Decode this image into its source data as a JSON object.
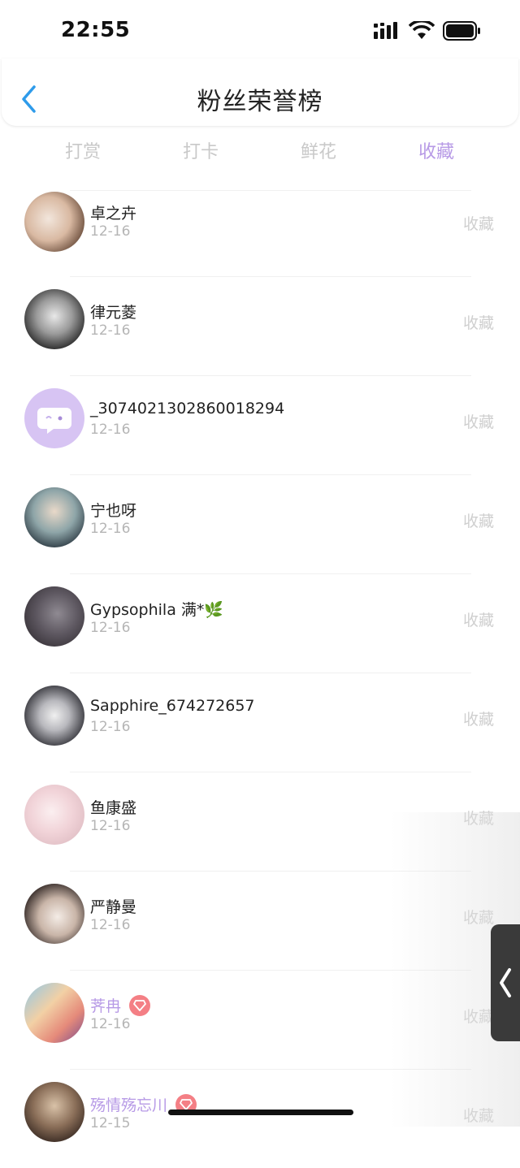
{
  "status_bar": {
    "time": "22:55"
  },
  "header": {
    "title": "粉丝荣誉榜"
  },
  "tabs": [
    {
      "label": "打赏",
      "active": false
    },
    {
      "label": "打卡",
      "active": false
    },
    {
      "label": "鲜花",
      "active": false
    },
    {
      "label": "收藏",
      "active": true
    }
  ],
  "colors": {
    "accent": "#b79ae6",
    "badge": "#f47f85",
    "muted": "#cfcfcf"
  },
  "fans": [
    {
      "name": "卓之卉",
      "date": "12-16",
      "action": "收藏",
      "highlight": false,
      "badge": false
    },
    {
      "name": "律元菱",
      "date": "12-16",
      "action": "收藏",
      "highlight": false,
      "badge": false
    },
    {
      "name": "_3074021302860018294",
      "date": "12-16",
      "action": "收藏",
      "highlight": false,
      "badge": false
    },
    {
      "name": "宁也呀",
      "date": "12-16",
      "action": "收藏",
      "highlight": false,
      "badge": false
    },
    {
      "name": "Gypsophila 满*🌿",
      "date": "12-16",
      "action": "收藏",
      "highlight": false,
      "badge": false
    },
    {
      "name": "Sapphire_674272657",
      "date": "12-16",
      "action": "收藏",
      "highlight": false,
      "badge": false
    },
    {
      "name": "鱼康盛",
      "date": "12-16",
      "action": "收藏",
      "highlight": false,
      "badge": false
    },
    {
      "name": "严静曼",
      "date": "12-16",
      "action": "收藏",
      "highlight": false,
      "badge": false
    },
    {
      "name": "荠冉",
      "date": "12-16",
      "action": "收藏",
      "highlight": true,
      "badge": true
    },
    {
      "name": "殇情殇忘川",
      "date": "12-15",
      "action": "收藏",
      "highlight": true,
      "badge": true
    }
  ]
}
